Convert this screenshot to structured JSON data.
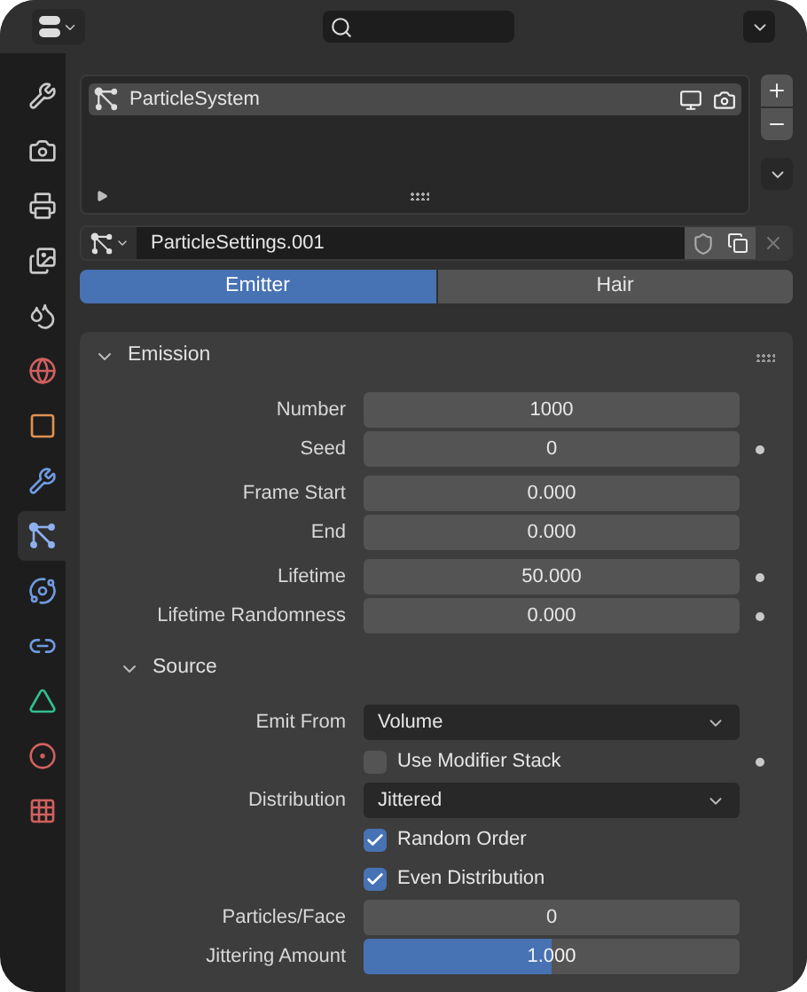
{
  "sidebar": [
    {
      "kind": "tool",
      "selected": false
    },
    {
      "kind": "render",
      "selected": false
    },
    {
      "kind": "output",
      "selected": false
    },
    {
      "kind": "view_layer",
      "selected": false
    },
    {
      "kind": "scene",
      "selected": false
    },
    {
      "kind": "world",
      "selected": false
    },
    {
      "kind": "object",
      "selected": false
    },
    {
      "kind": "modifiers",
      "selected": false
    },
    {
      "kind": "particles",
      "selected": true
    },
    {
      "kind": "physics",
      "selected": false
    },
    {
      "kind": "constraints",
      "selected": false
    },
    {
      "kind": "data",
      "selected": false
    },
    {
      "kind": "material",
      "selected": false
    },
    {
      "kind": "texture",
      "selected": false
    }
  ],
  "particle_list": {
    "items": [
      {
        "name": "ParticleSystem",
        "selected": true
      }
    ]
  },
  "settings": {
    "name": "ParticleSettings.001"
  },
  "tabs": [
    {
      "label": "Emitter",
      "selected": true
    },
    {
      "label": "Hair",
      "selected": false
    }
  ],
  "emission": {
    "title": "Emission",
    "expanded": true,
    "groups": [
      [
        {
          "kind": "number",
          "label": "Number",
          "value": "1000",
          "animatable": false
        },
        {
          "kind": "number",
          "label": "Seed",
          "value": "0",
          "animatable": true
        }
      ],
      [
        {
          "kind": "number",
          "label": "Frame Start",
          "value": "0.000",
          "animatable": false
        },
        {
          "kind": "number",
          "label": "End",
          "value": "0.000",
          "animatable": false
        }
      ],
      [
        {
          "kind": "number",
          "label": "Lifetime",
          "value": "50.000",
          "animatable": true
        },
        {
          "kind": "number",
          "label": "Lifetime Randomness",
          "value": "0.000",
          "animatable": true
        }
      ]
    ]
  },
  "source": {
    "title": "Source",
    "expanded": true,
    "groups": [
      [
        {
          "kind": "dropdown",
          "label": "Emit From",
          "value": "Volume",
          "animatable": false
        },
        {
          "kind": "checkbox",
          "label": "Use Modifier Stack",
          "checked": false,
          "animatable": true
        },
        {
          "kind": "dropdown",
          "label": "Distribution",
          "value": "Jittered",
          "animatable": false
        },
        {
          "kind": "checkbox",
          "label": "Random Order",
          "checked": true,
          "animatable": false
        },
        {
          "kind": "checkbox",
          "label": "Even Distribution",
          "checked": true,
          "animatable": false
        },
        {
          "kind": "number",
          "label": "Particles/Face",
          "value": "0",
          "animatable": false
        },
        {
          "kind": "slider",
          "label": "Jittering Amount",
          "value": "1.000",
          "level": 0.5,
          "animatable": false
        }
      ]
    ]
  }
}
